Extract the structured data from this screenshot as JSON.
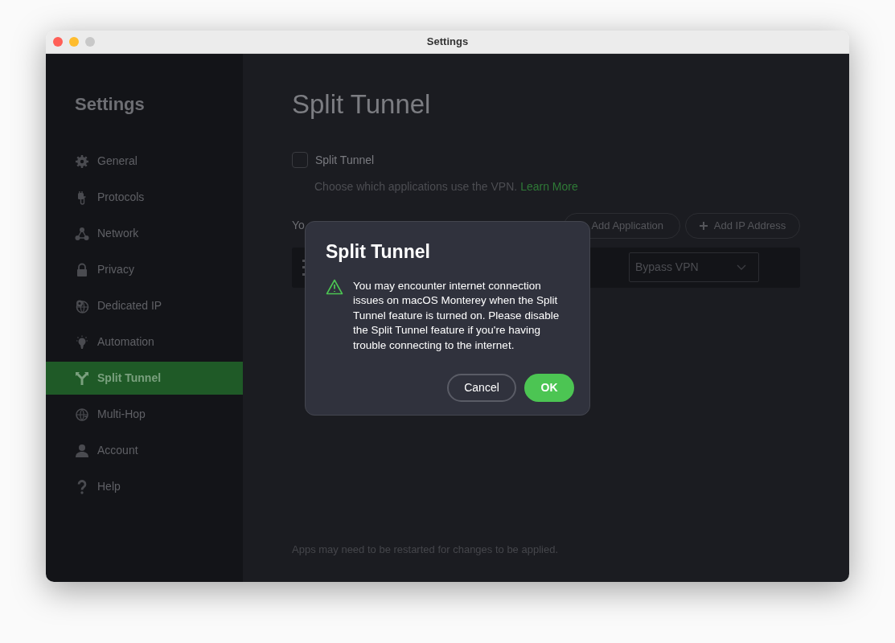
{
  "window": {
    "title": "Settings"
  },
  "sidebar": {
    "title": "Settings",
    "items": [
      {
        "label": "General",
        "selected": false
      },
      {
        "label": "Protocols",
        "selected": false
      },
      {
        "label": "Network",
        "selected": false
      },
      {
        "label": "Privacy",
        "selected": false
      },
      {
        "label": "Dedicated IP",
        "selected": false
      },
      {
        "label": "Automation",
        "selected": false
      },
      {
        "label": "Split Tunnel",
        "selected": true
      },
      {
        "label": "Multi-Hop",
        "selected": false
      },
      {
        "label": "Account",
        "selected": false
      },
      {
        "label": "Help",
        "selected": false
      }
    ]
  },
  "main": {
    "title": "Split Tunnel",
    "toggle": {
      "label": "Split Tunnel",
      "checked": false
    },
    "description": "Choose which applications use the VPN.",
    "link": "Learn More",
    "list_label": "Yo",
    "buttons": [
      "Add Application",
      "Add IP Address"
    ],
    "row": {
      "mode": "Bypass VPN"
    },
    "footer": "Apps may need to be restarted for changes to be applied."
  },
  "dialog": {
    "title": "Split Tunnel",
    "message": "You may encounter internet connection issues on macOS Monterey when the Split Tunnel feature is turned on. Please disable the Split Tunnel feature if you're having trouble connecting to the internet.",
    "cancel": "Cancel",
    "ok": "OK"
  }
}
